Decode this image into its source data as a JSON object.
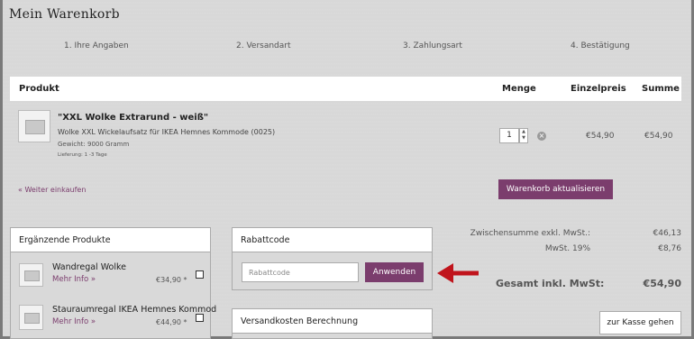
{
  "page_title": "Mein Warenkorb",
  "steps": [
    "1.  Ihre Angaben",
    "2.  Versandart",
    "3.  Zahlungsart",
    "4.  Bestätigung"
  ],
  "cart_header": {
    "product": "Produkt",
    "quantity": "Menge",
    "unit_price": "Einzelpreis",
    "total": "Summe"
  },
  "item": {
    "name": "\"XXL Wolke Extrarund - weiß\"",
    "description": "Wolke XXL Wickelaufsatz für IKEA Hemnes Kommode (0025)",
    "weight": "Gewicht: 9000 Gramm",
    "delivery": "Lieferung: 1 -3 Tage",
    "quantity": "1",
    "unit_price": "€54,90",
    "total": "€54,90"
  },
  "continue_link": "« Weiter einkaufen",
  "update_button": "Warenkorb aktualisieren",
  "related": {
    "title": "Ergänzende Produkte",
    "items": [
      {
        "name": "Wandregal Wolke",
        "more": "Mehr Info »",
        "price": "€34,90 *"
      },
      {
        "name": "Stauraumregal IKEA Hemnes Kommod",
        "more": "Mehr Info »",
        "price": "€44,90 *"
      }
    ]
  },
  "coupon": {
    "title": "Rabattcode",
    "placeholder": "Rabattcode",
    "apply_label": "Anwenden"
  },
  "shipping": {
    "title": "Versandkosten Berechnung"
  },
  "summary": {
    "subtotal_label": "Zwischensumme exkl. MwSt.:",
    "subtotal_value": "€46,13",
    "tax_label": "MwSt. 19%",
    "tax_value": "€8,76",
    "total_label": "Gesamt inkl. MwSt:",
    "total_value": "€54,90"
  },
  "checkout_button": "zur Kasse gehen",
  "colors": {
    "accent": "#7b3d6d",
    "annotation_arrow": "#c0141c"
  }
}
